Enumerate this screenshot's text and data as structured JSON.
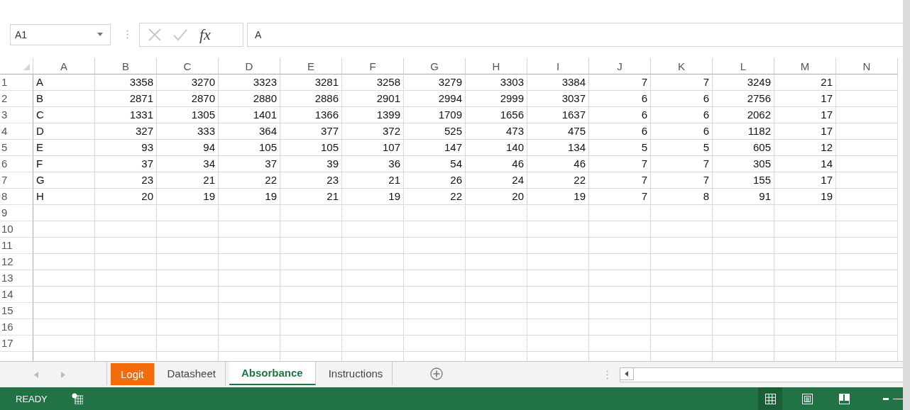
{
  "formula_bar": {
    "name_box": "A1",
    "function_label": "fx",
    "formula": "A"
  },
  "columns": [
    "A",
    "B",
    "C",
    "D",
    "E",
    "F",
    "G",
    "H",
    "I",
    "J",
    "K",
    "L",
    "M",
    "N"
  ],
  "rows": [
    {
      "number": "1",
      "label": "A",
      "values": [
        "3358",
        "3270",
        "3323",
        "3281",
        "3258",
        "3279",
        "3303",
        "3384",
        "7",
        "7",
        "3249",
        "21"
      ]
    },
    {
      "number": "2",
      "label": "B",
      "values": [
        "2871",
        "2870",
        "2880",
        "2886",
        "2901",
        "2994",
        "2999",
        "3037",
        "6",
        "6",
        "2756",
        "17"
      ]
    },
    {
      "number": "3",
      "label": "C",
      "values": [
        "1331",
        "1305",
        "1401",
        "1366",
        "1399",
        "1709",
        "1656",
        "1637",
        "6",
        "6",
        "2062",
        "17"
      ]
    },
    {
      "number": "4",
      "label": "D",
      "values": [
        "327",
        "333",
        "364",
        "377",
        "372",
        "525",
        "473",
        "475",
        "6",
        "6",
        "1182",
        "17"
      ]
    },
    {
      "number": "5",
      "label": "E",
      "values": [
        "93",
        "94",
        "105",
        "105",
        "107",
        "147",
        "140",
        "134",
        "5",
        "5",
        "605",
        "12"
      ]
    },
    {
      "number": "6",
      "label": "F",
      "values": [
        "37",
        "34",
        "37",
        "39",
        "36",
        "54",
        "46",
        "46",
        "7",
        "7",
        "305",
        "14"
      ]
    },
    {
      "number": "7",
      "label": "G",
      "values": [
        "23",
        "21",
        "22",
        "23",
        "21",
        "26",
        "24",
        "22",
        "7",
        "7",
        "155",
        "17"
      ]
    },
    {
      "number": "8",
      "label": "H",
      "values": [
        "20",
        "19",
        "19",
        "21",
        "19",
        "22",
        "20",
        "19",
        "7",
        "8",
        "91",
        "19"
      ]
    },
    {
      "number": "9"
    },
    {
      "number": "10"
    },
    {
      "number": "11"
    },
    {
      "number": "12"
    },
    {
      "number": "13"
    },
    {
      "number": "14"
    },
    {
      "number": "15"
    },
    {
      "number": "16"
    },
    {
      "number": "17"
    }
  ],
  "sheet_tabs": [
    {
      "label": "Logit",
      "selected": false,
      "color": "#f26c0c"
    },
    {
      "label": "Datasheet",
      "selected": false
    },
    {
      "label": "Absorbance",
      "selected": true
    },
    {
      "label": "Instructions",
      "selected": false
    }
  ],
  "status_bar": {
    "mode": "READY",
    "view_buttons": [
      {
        "kind": "normal",
        "selected": true
      },
      {
        "kind": "page-layout",
        "selected": false
      },
      {
        "kind": "page-break",
        "selected": false
      }
    ]
  }
}
